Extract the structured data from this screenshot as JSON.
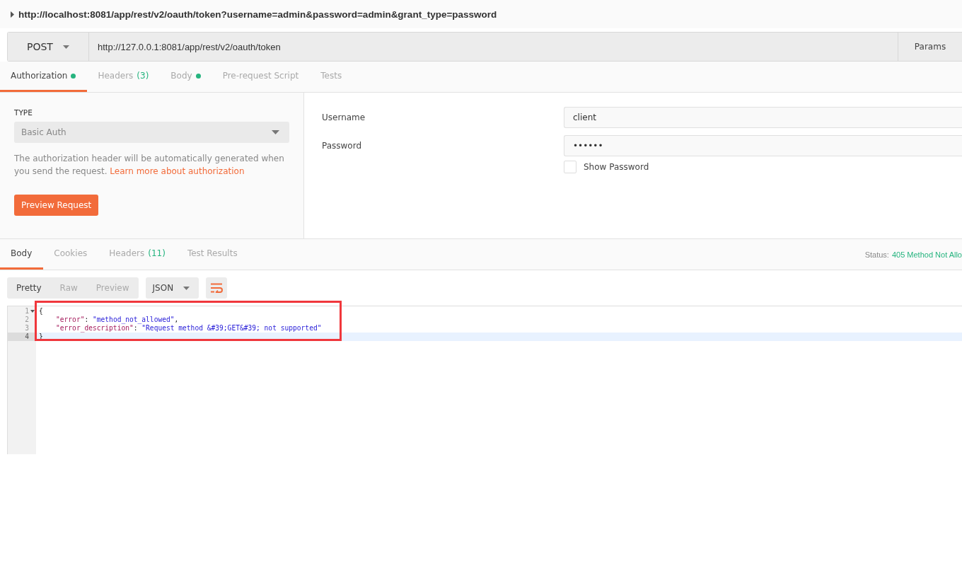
{
  "request_title": "http://localhost:8081/app/rest/v2/oauth/token?username=admin&password=admin&grant_type=password",
  "request": {
    "method": "POST",
    "url": "http://127.0.0.1:8081/app/rest/v2/oauth/token",
    "params_button": "Params"
  },
  "request_tabs": [
    {
      "label": "Authorization",
      "dot": true,
      "selected": true
    },
    {
      "label": "Headers",
      "count": "(3)",
      "dot": false,
      "selected": false
    },
    {
      "label": "Body",
      "dot": true,
      "selected": false
    },
    {
      "label": "Pre-request Script",
      "dot": false,
      "selected": false
    },
    {
      "label": "Tests",
      "dot": false,
      "selected": false
    }
  ],
  "auth": {
    "type_label": "TYPE",
    "type_value": "Basic Auth",
    "description": "The authorization header will be automatically generated when you send the request.",
    "learn_more": "Learn more about authorization",
    "preview_button": "Preview Request",
    "fields": [
      {
        "label": "Username",
        "value": "client"
      },
      {
        "label": "Password",
        "value": "••••••"
      }
    ],
    "show_password": {
      "label": "Show Password",
      "checked": false
    }
  },
  "response_tabs": [
    {
      "label": "Body",
      "selected": true
    },
    {
      "label": "Cookies",
      "selected": false
    },
    {
      "label": "Headers",
      "count": "(11)",
      "selected": false
    },
    {
      "label": "Test Results",
      "selected": false
    }
  ],
  "status": {
    "label": "Status:",
    "value": "405 Method Not Allo"
  },
  "view_modes": [
    {
      "label": "Pretty",
      "selected": true
    },
    {
      "label": "Raw",
      "selected": false
    },
    {
      "label": "Preview",
      "selected": false
    }
  ],
  "format": "JSON",
  "code_lines": [
    {
      "number": "1",
      "foldable": true,
      "selected": false,
      "tokens": [
        {
          "kind": "punct",
          "text": "{"
        }
      ]
    },
    {
      "number": "2",
      "foldable": false,
      "selected": false,
      "tokens": [
        {
          "kind": "key",
          "text": "\"error\""
        },
        {
          "kind": "punct",
          "text": ": "
        },
        {
          "kind": "string",
          "text": "\"method_not_allowed\""
        },
        {
          "kind": "punct",
          "text": ","
        }
      ]
    },
    {
      "number": "3",
      "foldable": false,
      "selected": false,
      "tokens": [
        {
          "kind": "key",
          "text": "\"error_description\""
        },
        {
          "kind": "punct",
          "text": ": "
        },
        {
          "kind": "string",
          "text": "\"Request method &#39;GET&#39; not supported\""
        }
      ]
    },
    {
      "number": "4",
      "foldable": false,
      "selected": true,
      "tokens": [
        {
          "kind": "punct",
          "text": "}"
        }
      ]
    }
  ]
}
